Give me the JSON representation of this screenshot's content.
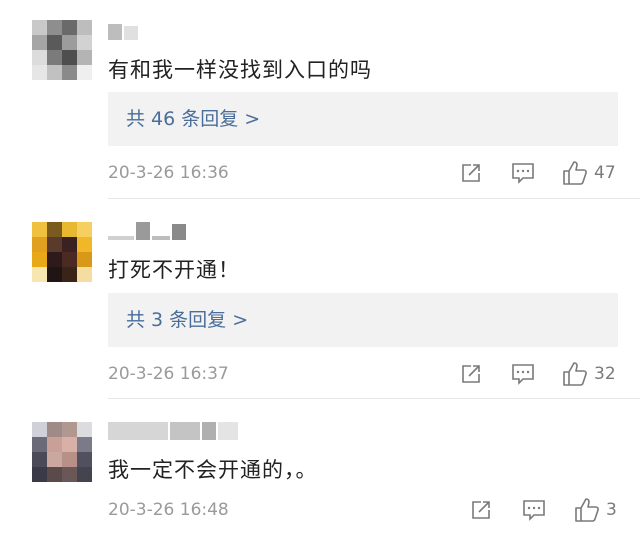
{
  "comments": [
    {
      "text": "有和我一样没找到入口的吗",
      "replies_label": "共 46 条回复 >",
      "time": "20-3-26 16:36",
      "likes": "47"
    },
    {
      "text": "打死不开通！",
      "replies_label": "共 3 条回复 >",
      "time": "20-3-26 16:37",
      "likes": "32"
    },
    {
      "text": "我一定不会开通的，。",
      "time": "20-3-26 16:48",
      "likes": "3"
    }
  ],
  "colors": {
    "link": "#4a6d9a",
    "meta": "#9a9a9a",
    "reply_bg": "#f2f2f2"
  }
}
